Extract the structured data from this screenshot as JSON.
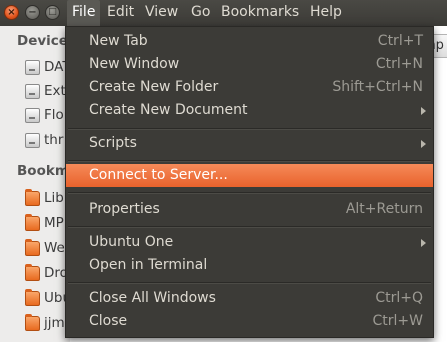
{
  "menubar": {
    "items": [
      "File",
      "Edit",
      "View",
      "Go",
      "Bookmarks",
      "Help"
    ],
    "active_index": 0
  },
  "window_buttons": {
    "close": "×",
    "minimize": "−",
    "maximize": "□"
  },
  "sidebar": {
    "devices_title": "Devices",
    "devices": [
      "DAT",
      "Ext",
      "Flo",
      "thr"
    ],
    "bookmarks_title": "Bookm",
    "bookmarks": [
      "Lib",
      "MP",
      "We",
      "Dro",
      "Ubu",
      "jjm"
    ]
  },
  "path_bar": {
    "partial_text": "mp"
  },
  "file_menu": {
    "items": [
      {
        "label": "New Tab",
        "accel": "Ctrl+T"
      },
      {
        "label": "New Window",
        "accel": "Ctrl+N"
      },
      {
        "label": "Create New Folder",
        "accel": "Shift+Ctrl+N"
      },
      {
        "label": "Create New Document",
        "accel": "",
        "submenu": true
      },
      {
        "label": "Scripts",
        "accel": "",
        "submenu": true
      },
      {
        "label": "Connect to Server...",
        "accel": "",
        "highlighted": true
      },
      {
        "label": "Properties",
        "accel": "Alt+Return"
      },
      {
        "label": "Ubuntu One",
        "accel": "",
        "submenu": true
      },
      {
        "label": "Open in Terminal",
        "accel": ""
      },
      {
        "label": "Close All Windows",
        "accel": "Ctrl+Q"
      },
      {
        "label": "Close",
        "accel": "Ctrl+W"
      }
    ]
  },
  "colors": {
    "menu_bg": "#3c3b37",
    "highlight": "#f07746",
    "menu_text": "#dfdbd2",
    "folder_orange": "#e86a1f"
  }
}
